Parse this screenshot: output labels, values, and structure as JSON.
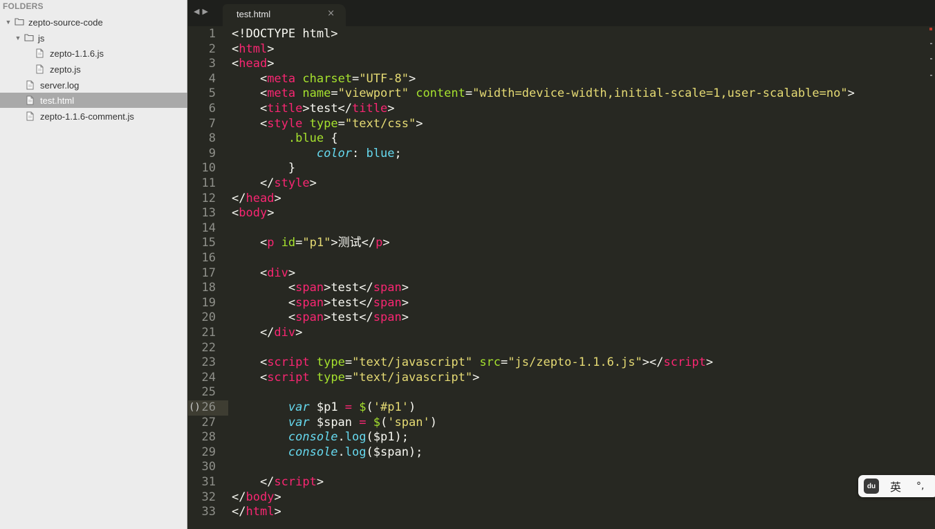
{
  "sidebar": {
    "header": "FOLDERS",
    "tree": [
      {
        "label": "zepto-source-code",
        "type": "folder",
        "depth": 0,
        "expanded": true
      },
      {
        "label": "js",
        "type": "folder",
        "depth": 1,
        "expanded": true
      },
      {
        "label": "zepto-1.1.6.js",
        "type": "file",
        "depth": 2
      },
      {
        "label": "zepto.js",
        "type": "file",
        "depth": 2
      },
      {
        "label": "server.log",
        "type": "file",
        "depth": 1
      },
      {
        "label": "test.html",
        "type": "file",
        "depth": 1,
        "selected": true
      },
      {
        "label": "zepto-1.1.6-comment.js",
        "type": "file",
        "depth": 1
      }
    ]
  },
  "tabbar": {
    "nav_back": "◀",
    "nav_forward": "▶",
    "active_tab": {
      "label": "test.html",
      "close": "×"
    }
  },
  "editor": {
    "current_line": 26,
    "bracket_marker": "()",
    "lines": [
      [
        [
          "p",
          "<!DOCTYPE html>"
        ]
      ],
      [
        [
          "p",
          "<"
        ],
        [
          "t",
          "html"
        ],
        [
          "p",
          ">"
        ]
      ],
      [
        [
          "p",
          "<"
        ],
        [
          "t",
          "head"
        ],
        [
          "p",
          ">"
        ]
      ],
      [
        [
          "p",
          "    <"
        ],
        [
          "t",
          "meta"
        ],
        [
          "p",
          " "
        ],
        [
          "a",
          "charset"
        ],
        [
          "p",
          "="
        ],
        [
          "s",
          "\"UTF-8\""
        ],
        [
          "p",
          ">"
        ]
      ],
      [
        [
          "p",
          "    <"
        ],
        [
          "t",
          "meta"
        ],
        [
          "p",
          " "
        ],
        [
          "a",
          "name"
        ],
        [
          "p",
          "="
        ],
        [
          "s",
          "\"viewport\""
        ],
        [
          "p",
          " "
        ],
        [
          "a",
          "content"
        ],
        [
          "p",
          "="
        ],
        [
          "s",
          "\"width=device-width,initial-scale=1,user-scalable=no\""
        ],
        [
          "p",
          ">"
        ]
      ],
      [
        [
          "p",
          "    <"
        ],
        [
          "t",
          "title"
        ],
        [
          "p",
          ">test</"
        ],
        [
          "t",
          "title"
        ],
        [
          "p",
          ">"
        ]
      ],
      [
        [
          "p",
          "    <"
        ],
        [
          "t",
          "style"
        ],
        [
          "p",
          " "
        ],
        [
          "a",
          "type"
        ],
        [
          "p",
          "="
        ],
        [
          "s",
          "\"text/css\""
        ],
        [
          "p",
          ">"
        ]
      ],
      [
        [
          "p",
          "        "
        ],
        [
          "a",
          ".blue"
        ],
        [
          "p",
          " {"
        ]
      ],
      [
        [
          "p",
          "            "
        ],
        [
          "k",
          "color"
        ],
        [
          "p",
          ": "
        ],
        [
          "f",
          "blue"
        ],
        [
          "p",
          ";"
        ]
      ],
      [
        [
          "p",
          "        }"
        ]
      ],
      [
        [
          "p",
          "    </"
        ],
        [
          "t",
          "style"
        ],
        [
          "p",
          ">"
        ]
      ],
      [
        [
          "p",
          "</"
        ],
        [
          "t",
          "head"
        ],
        [
          "p",
          ">"
        ]
      ],
      [
        [
          "p",
          "<"
        ],
        [
          "t",
          "body"
        ],
        [
          "p",
          ">"
        ]
      ],
      [],
      [
        [
          "p",
          "    <"
        ],
        [
          "t",
          "p"
        ],
        [
          "p",
          " "
        ],
        [
          "a",
          "id"
        ],
        [
          "p",
          "="
        ],
        [
          "s",
          "\"p1\""
        ],
        [
          "p",
          ">测试</"
        ],
        [
          "t",
          "p"
        ],
        [
          "p",
          ">"
        ]
      ],
      [],
      [
        [
          "p",
          "    <"
        ],
        [
          "t",
          "div"
        ],
        [
          "p",
          ">"
        ]
      ],
      [
        [
          "p",
          "        <"
        ],
        [
          "t",
          "span"
        ],
        [
          "p",
          ">test</"
        ],
        [
          "t",
          "span"
        ],
        [
          "p",
          ">"
        ]
      ],
      [
        [
          "p",
          "        <"
        ],
        [
          "t",
          "span"
        ],
        [
          "p",
          ">test</"
        ],
        [
          "t",
          "span"
        ],
        [
          "p",
          ">"
        ]
      ],
      [
        [
          "p",
          "        <"
        ],
        [
          "t",
          "span"
        ],
        [
          "p",
          ">test</"
        ],
        [
          "t",
          "span"
        ],
        [
          "p",
          ">"
        ]
      ],
      [
        [
          "p",
          "    </"
        ],
        [
          "t",
          "div"
        ],
        [
          "p",
          ">"
        ]
      ],
      [],
      [
        [
          "p",
          "    <"
        ],
        [
          "t",
          "script"
        ],
        [
          "p",
          " "
        ],
        [
          "a",
          "type"
        ],
        [
          "p",
          "="
        ],
        [
          "s",
          "\"text/javascript\""
        ],
        [
          "p",
          " "
        ],
        [
          "a",
          "src"
        ],
        [
          "p",
          "="
        ],
        [
          "s",
          "\"js/zepto-1.1.6.js\""
        ],
        [
          "p",
          "></"
        ],
        [
          "t",
          "script"
        ],
        [
          "p",
          ">"
        ]
      ],
      [
        [
          "p",
          "    <"
        ],
        [
          "t",
          "script"
        ],
        [
          "p",
          " "
        ],
        [
          "a",
          "type"
        ],
        [
          "p",
          "="
        ],
        [
          "s",
          "\"text/javascript\""
        ],
        [
          "p",
          ">"
        ]
      ],
      [],
      [
        [
          "p",
          "        "
        ],
        [
          "k",
          "var"
        ],
        [
          "p",
          " $p1 "
        ],
        [
          "o",
          "="
        ],
        [
          "p",
          " "
        ],
        [
          "a",
          "$"
        ],
        [
          "p",
          "("
        ],
        [
          "s",
          "'#p1'"
        ],
        [
          "p",
          ")"
        ]
      ],
      [
        [
          "p",
          "        "
        ],
        [
          "k",
          "var"
        ],
        [
          "p",
          " $span "
        ],
        [
          "o",
          "="
        ],
        [
          "p",
          " "
        ],
        [
          "a",
          "$"
        ],
        [
          "p",
          "("
        ],
        [
          "s",
          "'span'"
        ],
        [
          "p",
          ")"
        ]
      ],
      [
        [
          "p",
          "        "
        ],
        [
          "k",
          "console"
        ],
        [
          "p",
          "."
        ],
        [
          "f",
          "log"
        ],
        [
          "p",
          "($p1);"
        ]
      ],
      [
        [
          "p",
          "        "
        ],
        [
          "k",
          "console"
        ],
        [
          "p",
          "."
        ],
        [
          "f",
          "log"
        ],
        [
          "p",
          "($span);"
        ]
      ],
      [],
      [
        [
          "p",
          "    </"
        ],
        [
          "t",
          "script"
        ],
        [
          "p",
          ">"
        ]
      ],
      [
        [
          "p",
          "</"
        ],
        [
          "t",
          "body"
        ],
        [
          "p",
          ">"
        ]
      ],
      [
        [
          "p",
          "</"
        ],
        [
          "t",
          "html"
        ],
        [
          "p",
          ">"
        ]
      ]
    ]
  },
  "ime": {
    "logo": "du",
    "language": "英",
    "punctuation": "°,"
  },
  "colors": {
    "background": "#272822",
    "tag": "#f92672",
    "attribute": "#a6e22e",
    "string": "#e6db74",
    "keyword": "#66d9ef",
    "text": "#f8f8f2"
  }
}
